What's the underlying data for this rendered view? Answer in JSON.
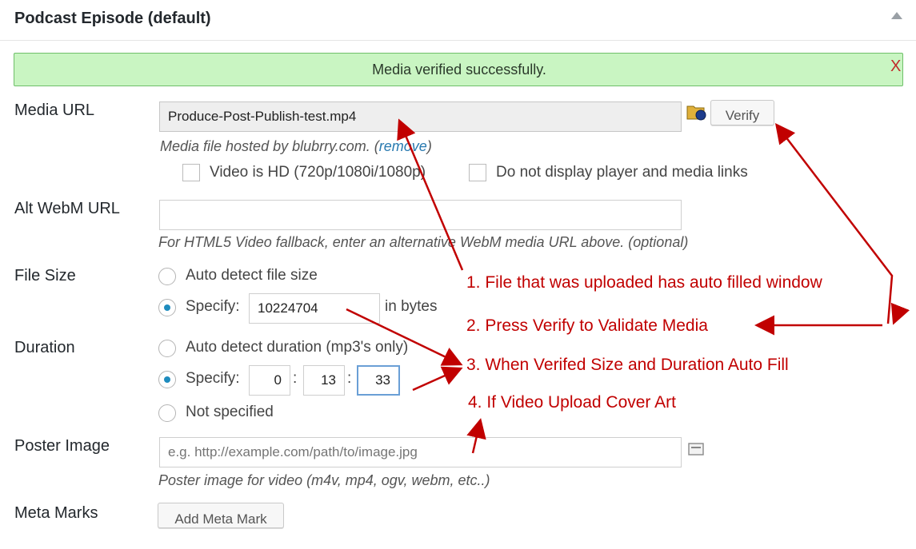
{
  "header": {
    "title": "Podcast Episode (default)"
  },
  "notice": {
    "text": "Media verified successfully.",
    "close": "X"
  },
  "media_url": {
    "label": "Media URL",
    "value": "Produce-Post-Publish-test.mp4",
    "verify_label": "Verify",
    "help_prefix": "Media file hosted by blubrry.com. (",
    "help_link": "remove",
    "help_suffix": ")",
    "video_hd_label": "Video is HD (720p/1080i/1080p)",
    "no_player_label": "Do not display player and media links"
  },
  "alt_webm": {
    "label": "Alt WebM URL",
    "value": "",
    "help": "For HTML5 Video fallback, enter an alternative WebM media URL above. (optional)"
  },
  "file_size": {
    "label": "File Size",
    "auto_label": "Auto detect file size",
    "specify_label": "Specify:",
    "value": "10224704",
    "unit": "in bytes"
  },
  "duration": {
    "label": "Duration",
    "auto_label": "Auto detect duration (mp3's only)",
    "specify_label": "Specify:",
    "hours": "0",
    "minutes": "13",
    "seconds": "33",
    "sep": ":",
    "not_specified_label": "Not specified"
  },
  "poster": {
    "label": "Poster Image",
    "placeholder": "e.g. http://example.com/path/to/image.jpg",
    "help": "Poster image for video (m4v, mp4, ogv, webm, etc..)"
  },
  "meta_marks": {
    "label": "Meta Marks",
    "button": "Add Meta Mark"
  },
  "annotations": [
    "1. File that was uploaded has auto filled window",
    "2. Press Verify to Validate Media",
    "3. When Verifed Size and Duration Auto Fill",
    "4. If Video Upload Cover Art"
  ],
  "colors": {
    "annotation": "#c10000",
    "notice_bg": "#c9f5c2",
    "radio_dot": "#1e8cbe"
  }
}
